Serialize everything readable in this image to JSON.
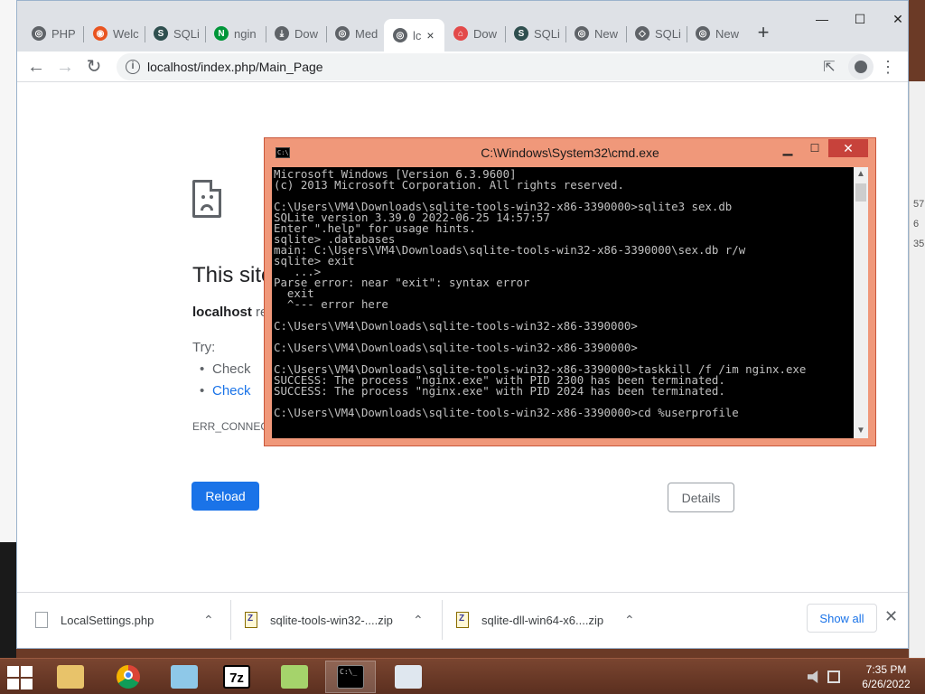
{
  "browser": {
    "tabs": [
      {
        "label": "PHP",
        "icon": "globe-icon"
      },
      {
        "label": "Welc",
        "icon": "ubuntu-icon"
      },
      {
        "label": "SQLi",
        "icon": "sqlite-icon"
      },
      {
        "label": "ngin",
        "icon": "nginx-icon"
      },
      {
        "label": "Dow",
        "icon": "download-icon"
      },
      {
        "label": "Med",
        "icon": "globe-icon"
      },
      {
        "label": "lc",
        "icon": "globe-icon",
        "active": true
      },
      {
        "label": "Dow",
        "icon": "download-site-icon"
      },
      {
        "label": "SQLi",
        "icon": "sqlite-icon"
      },
      {
        "label": "New",
        "icon": "chrome-icon"
      },
      {
        "label": "SQLi",
        "icon": "diamond-icon"
      },
      {
        "label": "New",
        "icon": "chrome-icon"
      }
    ],
    "active_tab_close": "×",
    "new_tab": "+",
    "window_controls": {
      "minimize": "—",
      "maximize": "☐",
      "close": "✕"
    },
    "nav": {
      "back": "←",
      "forward": "→",
      "reload": "↻"
    },
    "url": "localhost/index.php/Main_Page",
    "menu_icon": "⋮"
  },
  "error_page": {
    "title": "This site",
    "host": "localhost",
    "desc_rest": " re",
    "try_label": "Try:",
    "suggestions": [
      "Check",
      "Check"
    ],
    "error_code": "ERR_CONNECT",
    "reload_label": "Reload",
    "details_label": "Details"
  },
  "downloads": {
    "items": [
      {
        "name": "LocalSettings.php",
        "type": "file"
      },
      {
        "name": "sqlite-tools-win32-....zip",
        "type": "zip"
      },
      {
        "name": "sqlite-dll-win64-x6....zip",
        "type": "zip"
      }
    ],
    "show_all": "Show all",
    "close": "✕"
  },
  "cmd": {
    "title": "C:\\Windows\\System32\\cmd.exe",
    "icon_text": "C:\\",
    "close": "✕",
    "lines": [
      "Microsoft Windows [Version 6.3.9600]",
      "(c) 2013 Microsoft Corporation. All rights reserved.",
      "",
      "C:\\Users\\VM4\\Downloads\\sqlite-tools-win32-x86-3390000>sqlite3 sex.db",
      "SQLite version 3.39.0 2022-06-25 14:57:57",
      "Enter \".help\" for usage hints.",
      "sqlite> .databases",
      "main: C:\\Users\\VM4\\Downloads\\sqlite-tools-win32-x86-3390000\\sex.db r/w",
      "sqlite> exit",
      "   ...>",
      "Parse error: near \"exit\": syntax error",
      "  exit",
      "  ^--- error here",
      "",
      "C:\\Users\\VM4\\Downloads\\sqlite-tools-win32-x86-3390000>",
      "",
      "C:\\Users\\VM4\\Downloads\\sqlite-tools-win32-x86-3390000>",
      "",
      "C:\\Users\\VM4\\Downloads\\sqlite-tools-win32-x86-3390000>taskkill /f /im nginx.exe",
      "SUCCESS: The process \"nginx.exe\" with PID 2300 has been terminated.",
      "SUCCESS: The process \"nginx.exe\" with PID 2024 has been terminated.",
      "",
      "C:\\Users\\VM4\\Downloads\\sqlite-tools-win32-x86-3390000>cd %userprofile"
    ]
  },
  "desktop_side_text": [
    "57",
    "6",
    "35"
  ],
  "taskbar": {
    "apps": [
      {
        "name": "file-explorer-icon",
        "color": "#e8c36a"
      },
      {
        "name": "chrome-icon",
        "color": "#db4437"
      },
      {
        "name": "notepad-icon",
        "color": "#8ec8e8"
      },
      {
        "name": "7zip-icon",
        "color": "#ffffff",
        "text": "7z"
      },
      {
        "name": "notepad-plus-plus-icon",
        "color": "#a5d36b"
      },
      {
        "name": "cmd-icon",
        "color": "#000000",
        "active": true
      },
      {
        "name": "document-viewer-icon",
        "color": "#dfe7ef"
      }
    ],
    "time": "7:35 PM",
    "date": "6/26/2022"
  },
  "colors": {
    "accent": "#1a73e8",
    "cmd_frame": "#f0987a",
    "cmd_close": "#c7423b",
    "taskbar": "#6b3a26"
  }
}
